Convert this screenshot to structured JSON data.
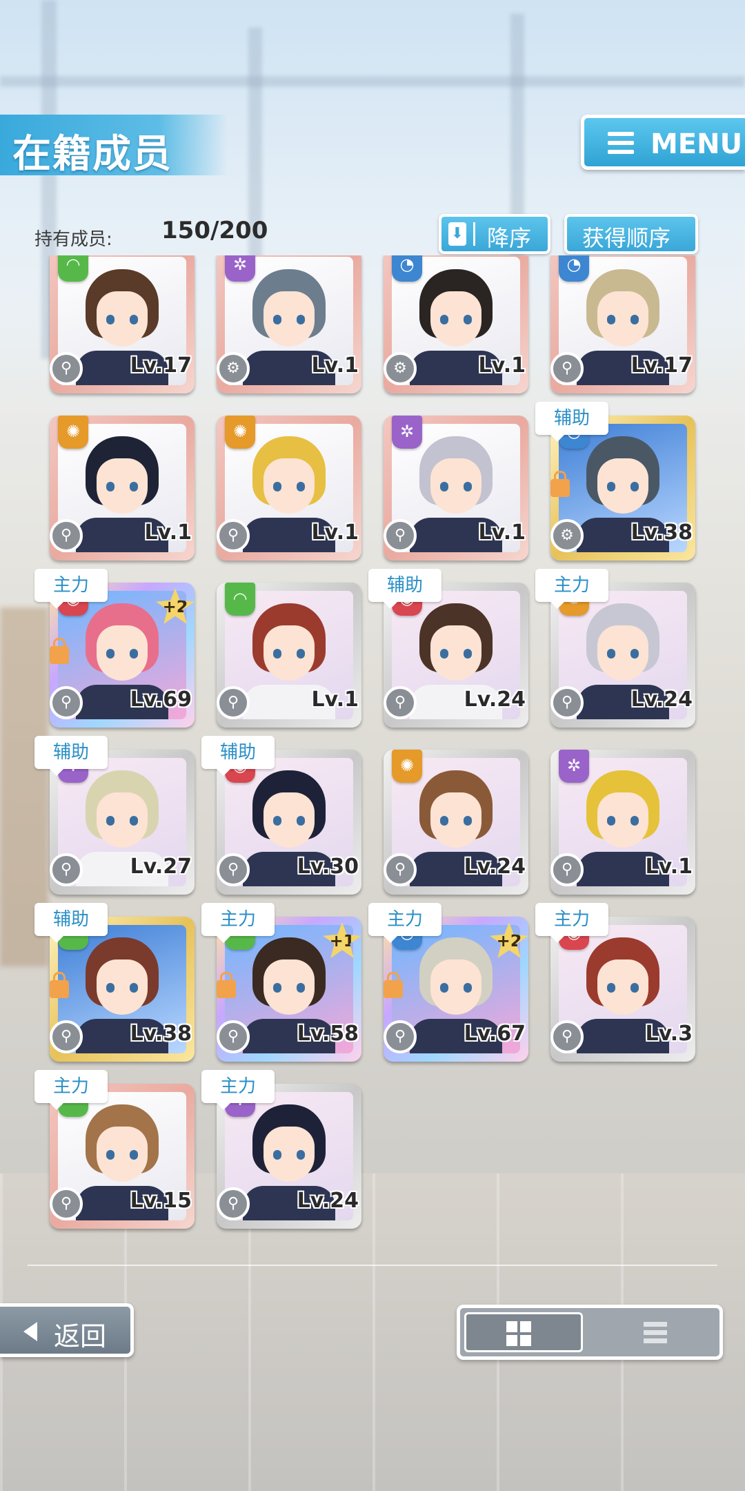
{
  "header": {
    "title": "在籍成员",
    "menu_label": "MENU"
  },
  "members": {
    "count_label": "持有成员:",
    "count_value": "150/200"
  },
  "sort": {
    "direction_label": "降序",
    "direction_icon": "⬇",
    "order_label": "获得顺序"
  },
  "colors": {
    "accent": "#3aa7d8",
    "role_text": "#2a8fc7"
  },
  "cards": [
    {
      "lv": "Lv.17",
      "role": "",
      "attr": "green",
      "frame": "pink",
      "hair": "#5a3a28",
      "weapon": "⚲"
    },
    {
      "lv": "Lv.1",
      "role": "",
      "attr": "purple",
      "frame": "pink",
      "hair": "#6c7d8e",
      "weapon": "⚙"
    },
    {
      "lv": "Lv.1",
      "role": "",
      "attr": "blue",
      "frame": "pink",
      "hair": "#2a2423",
      "weapon": "⚙"
    },
    {
      "lv": "Lv.17",
      "role": "",
      "attr": "blue",
      "frame": "pink",
      "hair": "#c9b991",
      "weapon": "⚲"
    },
    {
      "lv": "Lv.1",
      "role": "",
      "attr": "orange",
      "frame": "pink",
      "hair": "#1f2336",
      "weapon": "⚲"
    },
    {
      "lv": "Lv.1",
      "role": "",
      "attr": "orange",
      "frame": "pink",
      "hair": "#e7bf42",
      "weapon": "⚲"
    },
    {
      "lv": "Lv.1",
      "role": "",
      "attr": "purple",
      "frame": "pink",
      "hair": "#c2c2d0",
      "weapon": "⚲"
    },
    {
      "lv": "Lv.38",
      "role": "辅助",
      "attr": "blue",
      "frame": "gold",
      "hair": "#4a5866",
      "weapon": "⚙",
      "locked": true
    },
    {
      "lv": "Lv.69",
      "role": "主力",
      "attr": "red",
      "frame": "rainbow",
      "hair": "#e86f8b",
      "weapon": "⚲",
      "locked": true,
      "plus": "+2"
    },
    {
      "lv": "Lv.1",
      "role": "",
      "attr": "green",
      "frame": "silver",
      "hair": "#9a3b2e",
      "weapon": "⚲"
    },
    {
      "lv": "Lv.24",
      "role": "辅助",
      "attr": "red",
      "frame": "silver",
      "hair": "#4b3427",
      "weapon": "⚲"
    },
    {
      "lv": "Lv.24",
      "role": "主力",
      "attr": "orange",
      "frame": "silver",
      "hair": "#c7c7d4",
      "weapon": "⚲"
    },
    {
      "lv": "Lv.27",
      "role": "辅助",
      "attr": "purple",
      "frame": "silver",
      "hair": "#d9d4b0",
      "weapon": "⚲"
    },
    {
      "lv": "Lv.30",
      "role": "辅助",
      "attr": "red",
      "frame": "silver",
      "hair": "#1e2238",
      "weapon": "⚲"
    },
    {
      "lv": "Lv.24",
      "role": "",
      "attr": "orange",
      "frame": "silver",
      "hair": "#8a5a38",
      "weapon": "⚲"
    },
    {
      "lv": "Lv.1",
      "role": "",
      "attr": "purple",
      "frame": "silver",
      "hair": "#e5c23a",
      "weapon": "⚲"
    },
    {
      "lv": "Lv.38",
      "role": "辅助",
      "attr": "green",
      "frame": "gold",
      "hair": "#7a3a2c",
      "weapon": "⚲",
      "locked": true
    },
    {
      "lv": "Lv.58",
      "role": "主力",
      "attr": "green",
      "frame": "rainbow",
      "hair": "#3b2a22",
      "weapon": "⚲",
      "locked": true,
      "plus": "+1"
    },
    {
      "lv": "Lv.67",
      "role": "主力",
      "attr": "blue",
      "frame": "rainbow",
      "hair": "#d2d0c2",
      "weapon": "⚲",
      "locked": true,
      "plus": "+2"
    },
    {
      "lv": "Lv.3",
      "role": "主力",
      "attr": "red",
      "frame": "silver",
      "hair": "#9a3b2e",
      "weapon": "⚲"
    },
    {
      "lv": "Lv.15",
      "role": "主力",
      "attr": "green",
      "frame": "pink",
      "hair": "#a3734a",
      "weapon": "⚲"
    },
    {
      "lv": "Lv.24",
      "role": "主力",
      "attr": "purple",
      "frame": "silver",
      "hair": "#1e2238",
      "weapon": "⚲"
    }
  ],
  "footer": {
    "back_label": "返回"
  }
}
